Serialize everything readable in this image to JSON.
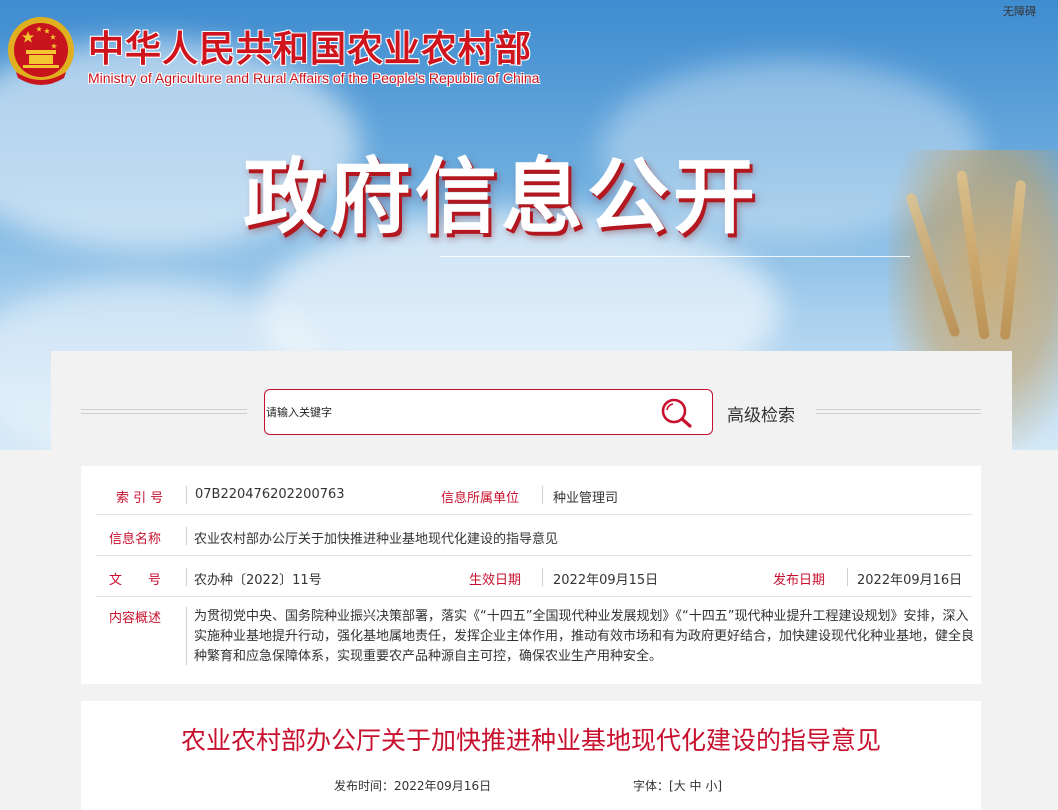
{
  "header": {
    "accessibility_link": "无障碍",
    "ministry_cn": "中华人民共和国农业农村部",
    "ministry_en": "Ministry of Agriculture and Rural Affairs of the People's Republic of China",
    "banner_title": "政府信息公开"
  },
  "search": {
    "placeholder": "请输入关键字",
    "advanced_label": "高级检索"
  },
  "info": {
    "index_label": "索 引 号",
    "index_value": "07B220476202200763",
    "unit_label": "信息所属单位",
    "unit_value": "种业管理司",
    "name_label": "信息名称",
    "name_value": "农业农村部办公厅关于加快推进种业基地现代化建设的指导意见",
    "doc_label": "文　　号",
    "doc_value": "农办种〔2022〕11号",
    "effective_label": "生效日期",
    "effective_value": "2022年09月15日",
    "publish_label": "发布日期",
    "publish_value": "2022年09月16日",
    "summary_label": "内容概述",
    "summary_value": "为贯彻党中央、国务院种业振兴决策部署，落实《“十四五”全国现代种业发展规划》《“十四五”现代种业提升工程建设规划》安排，深入实施种业基地提升行动，强化基地属地责任，发挥企业主体作用，推动有效市场和有为政府更好结合，加快建设现代化种业基地，健全良种繁育和应急保障体系，实现重要农产品种源自主可控，确保农业生产用种安全。"
  },
  "article": {
    "title": "农业农村部办公厅关于加快推进种业基地现代化建设的指导意见",
    "publish_time": "发布时间：2022年09月16日",
    "font_label": "字体：",
    "font_open": "[",
    "font_large": "大",
    "font_medium": "中",
    "font_small": "小",
    "font_close": "]"
  },
  "colors": {
    "accent": "#c8102e",
    "text": "#333333"
  }
}
